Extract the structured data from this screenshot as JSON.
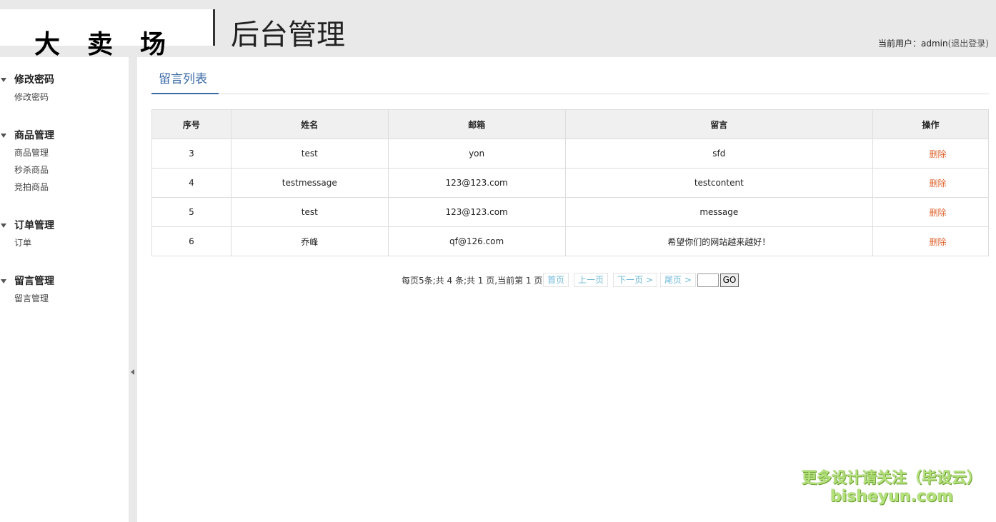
{
  "header": {
    "logo_text": "大卖场",
    "subtitle": "后台管理",
    "user_prefix": "当前用户：",
    "username": "admin",
    "logout_label": "(退出登录)"
  },
  "sidebar": {
    "groups": [
      {
        "title": "修改密码",
        "items": [
          "修改密码"
        ]
      },
      {
        "title": "商品管理",
        "items": [
          "商品管理",
          "秒杀商品",
          "竞拍商品"
        ]
      },
      {
        "title": "订单管理",
        "items": [
          "订单"
        ]
      },
      {
        "title": "留言管理",
        "items": [
          "留言管理"
        ]
      }
    ]
  },
  "main": {
    "tab_label": "留言列表",
    "table": {
      "headers": [
        "序号",
        "姓名",
        "邮箱",
        "留言",
        "操作"
      ],
      "rows": [
        {
          "id": "3",
          "name": "test",
          "email": "yon",
          "message": "sfd",
          "action": "删除"
        },
        {
          "id": "4",
          "name": "testmessage",
          "email": "123@123.com",
          "message": "testcontent",
          "action": "删除"
        },
        {
          "id": "5",
          "name": "test",
          "email": "123@123.com",
          "message": "message",
          "action": "删除"
        },
        {
          "id": "6",
          "name": "乔峰",
          "email": "qf@126.com",
          "message": "希望你们的网站越来越好！",
          "action": "删除"
        }
      ]
    },
    "pager": {
      "info": "每页5条;共 4 条;共 1 页,当前第 1 页",
      "first": "首页",
      "prev": "上一页",
      "next": "下一页 >",
      "last": "尾页 >",
      "go_label": "GO"
    }
  },
  "watermark": {
    "line1": "更多设计请关注（毕设云）",
    "line2": "bisheyun.com"
  },
  "colors": {
    "accent": "#3a6aa6",
    "delete": "#e0652f",
    "pager_link": "#6cb8d8",
    "header_bg": "#e9e9e9"
  }
}
